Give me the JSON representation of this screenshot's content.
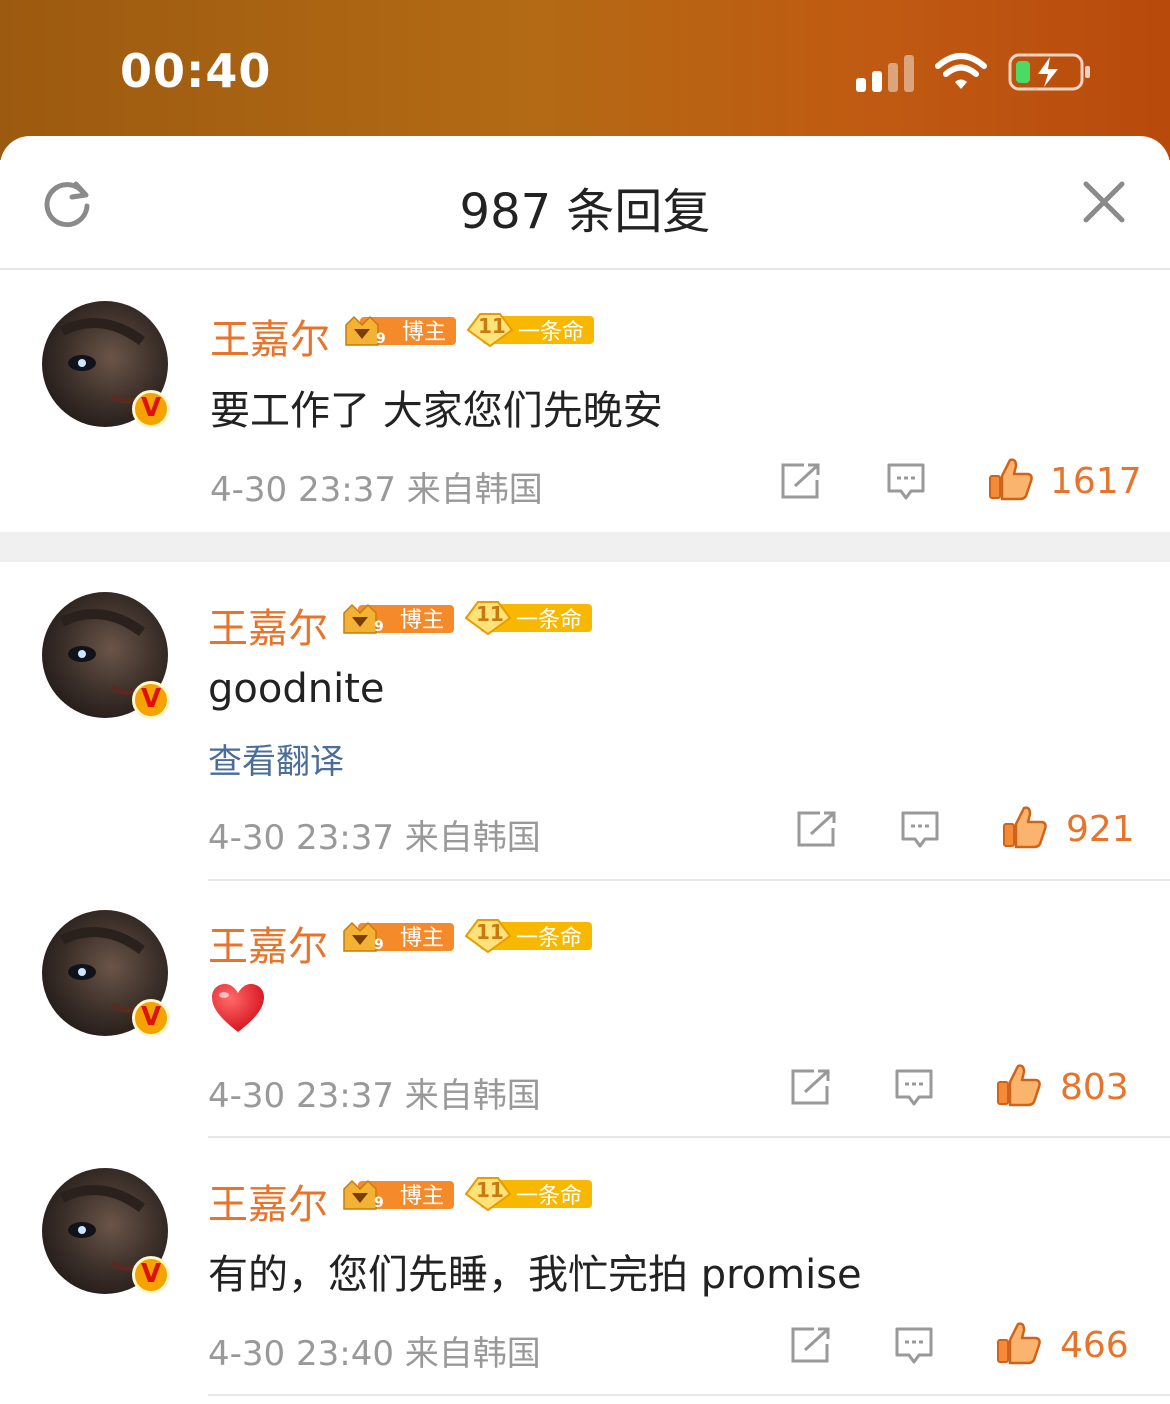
{
  "status_bar": {
    "time": "00:40"
  },
  "header": {
    "title": "987 条回复"
  },
  "comments": [
    {
      "user": "王嘉尔",
      "badge_blogger": "博主",
      "badge_fan_level": "11",
      "badge_fan_name": "一条命",
      "text": "要工作了 大家您们先晚安",
      "time": "4-30 23:37",
      "location": "来自韩国",
      "likes": "1617"
    },
    {
      "user": "王嘉尔",
      "badge_blogger": "博主",
      "badge_fan_level": "11",
      "badge_fan_name": "一条命",
      "text": "goodnite",
      "translate": "查看翻译",
      "time": "4-30 23:37",
      "location": "来自韩国",
      "likes": "921"
    },
    {
      "user": "王嘉尔",
      "badge_blogger": "博主",
      "badge_fan_level": "11",
      "badge_fan_name": "一条命",
      "emoji": "red-heart",
      "time": "4-30 23:37",
      "location": "来自韩国",
      "likes": "803"
    },
    {
      "user": "王嘉尔",
      "badge_blogger": "博主",
      "badge_fan_level": "11",
      "badge_fan_name": "一条命",
      "text": "有的，您们先睡，我忙完拍 promise",
      "time": "4-30 23:40",
      "location": "来自韩国",
      "likes": "466"
    }
  ],
  "verified_badge": "V",
  "colors": {
    "accent": "#e8742c",
    "link": "#4a6d99",
    "meta": "#999999"
  }
}
